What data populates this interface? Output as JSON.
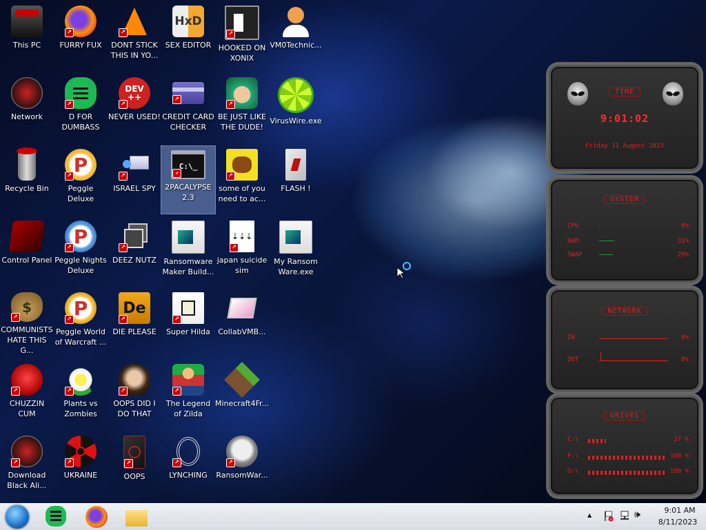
{
  "desktop": {
    "icons": [
      {
        "label": "This PC"
      },
      {
        "label": "FURRY FUX"
      },
      {
        "label": "DONT STICK THIS IN YO..."
      },
      {
        "label": "SEX EDITOR"
      },
      {
        "label": "HOOKED ON XONIX"
      },
      {
        "label": "VM0Technic..."
      },
      {
        "label": "Network"
      },
      {
        "label": "D FOR DUMBASS"
      },
      {
        "label": "NEVER USED!"
      },
      {
        "label": "CREDIT CARD CHECKER"
      },
      {
        "label": "BE JUST LIKE THE DUDE!"
      },
      {
        "label": "VirusWire.exe"
      },
      {
        "label": "Recycle Bin"
      },
      {
        "label": "Peggle Deluxe"
      },
      {
        "label": "ISRAEL SPY"
      },
      {
        "label": "2PACALYPSE 2.3"
      },
      {
        "label": "some of you need to ac..."
      },
      {
        "label": "FLASH !"
      },
      {
        "label": "Control Panel"
      },
      {
        "label": "Peggle Nights Deluxe"
      },
      {
        "label": "DEEZ NUTZ"
      },
      {
        "label": "Ransomware Maker Build..."
      },
      {
        "label": "japan suicide sim"
      },
      {
        "label": "My Ransom Ware.exe"
      },
      {
        "label": "COMMUNISTS HATE THIS G..."
      },
      {
        "label": "Peggle World of Warcraft ..."
      },
      {
        "label": "DIE PLEASE"
      },
      {
        "label": "Super Hilda"
      },
      {
        "label": "CollabVMB..."
      },
      {
        "label": "CHUZZIN CUM"
      },
      {
        "label": "Plants vs Zombies"
      },
      {
        "label": "OOPS DID I DO THAT"
      },
      {
        "label": "The Legend of Zilda"
      },
      {
        "label": "Minecraft4Fr..."
      },
      {
        "label": "Download Black Ali..."
      },
      {
        "label": "UKRAINE"
      },
      {
        "label": "OOPS"
      },
      {
        "label": "LYNCHING"
      },
      {
        "label": "RansomWar..."
      }
    ],
    "icon_badges": {
      "dev": "DEV",
      "dev_sub": "++",
      "de": "De",
      "cmd": "C:\\_",
      "dollar": "$"
    }
  },
  "widgets": {
    "time": {
      "title": "TIME",
      "clock": "9:01:02",
      "date": "Friday 11 August 2023"
    },
    "system": {
      "title": "SYSTEM",
      "cpu_label": "CPU",
      "ram_label": "RAM",
      "swap_label": "SWAP",
      "cpu_value": "0%",
      "ram_value": "31%",
      "swap_value": "29%",
      "cpu": 0.0,
      "ram": 0.31,
      "swap": 0.29
    },
    "network": {
      "title": "NETWORK",
      "in_label": "IN",
      "out_label": "OUT",
      "in_value": "0%",
      "out_value": "0%"
    },
    "drives": {
      "title": "DRIVES",
      "c_label": "C:\\",
      "f_label": "F:\\",
      "g_label": "G:\\",
      "c_value": "27 %",
      "f_value": "100 %",
      "g_value": "100 %",
      "c": 0.27,
      "f": 1.0,
      "g": 1.0
    }
  },
  "taskbar": {
    "time": "9:01 AM",
    "date": "8/11/2023",
    "tray_up": "▲",
    "volume": "🕪"
  },
  "colors": {
    "accent_red": "#e02020",
    "taskbar": "#e4e8ee"
  }
}
